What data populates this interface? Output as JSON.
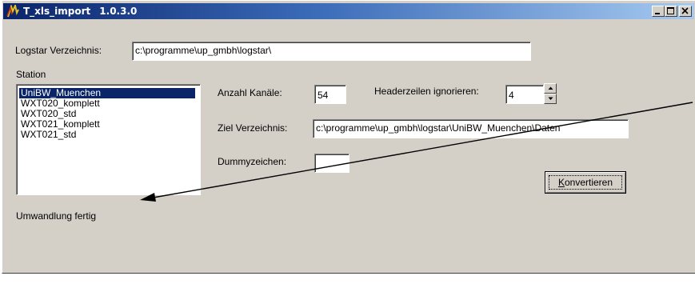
{
  "window": {
    "title": "T_xls_import",
    "version": "1.0.3.0"
  },
  "logstar": {
    "label": "Logstar Verzeichnis:",
    "value": "c:\\programme\\up_gmbh\\logstar\\"
  },
  "station": {
    "label": "Station",
    "items": [
      "UniBW_Muenchen",
      "WXT020_komplett",
      "WXT020_std",
      "WXT021_komplett",
      "WXT021_std"
    ],
    "selected_index": 0
  },
  "anzahl": {
    "label": "Anzahl Kanäle:",
    "value": "54"
  },
  "header": {
    "label": "Headerzeilen ignorieren:",
    "value": "4"
  },
  "ziel": {
    "label": "Ziel Verzeichnis:",
    "value": "c:\\programme\\up_gmbh\\logstar\\UniBW_Muenchen\\Daten"
  },
  "dummy": {
    "label": "Dummyzeichen:",
    "value": ""
  },
  "convert_button": {
    "label": "Konvertieren"
  },
  "status": {
    "text": "Umwandlung fertig"
  },
  "colors": {
    "title_start": "#0a246a",
    "title_end": "#a6caf0",
    "face": "#d4d0c8",
    "selection": "#0a246a"
  }
}
